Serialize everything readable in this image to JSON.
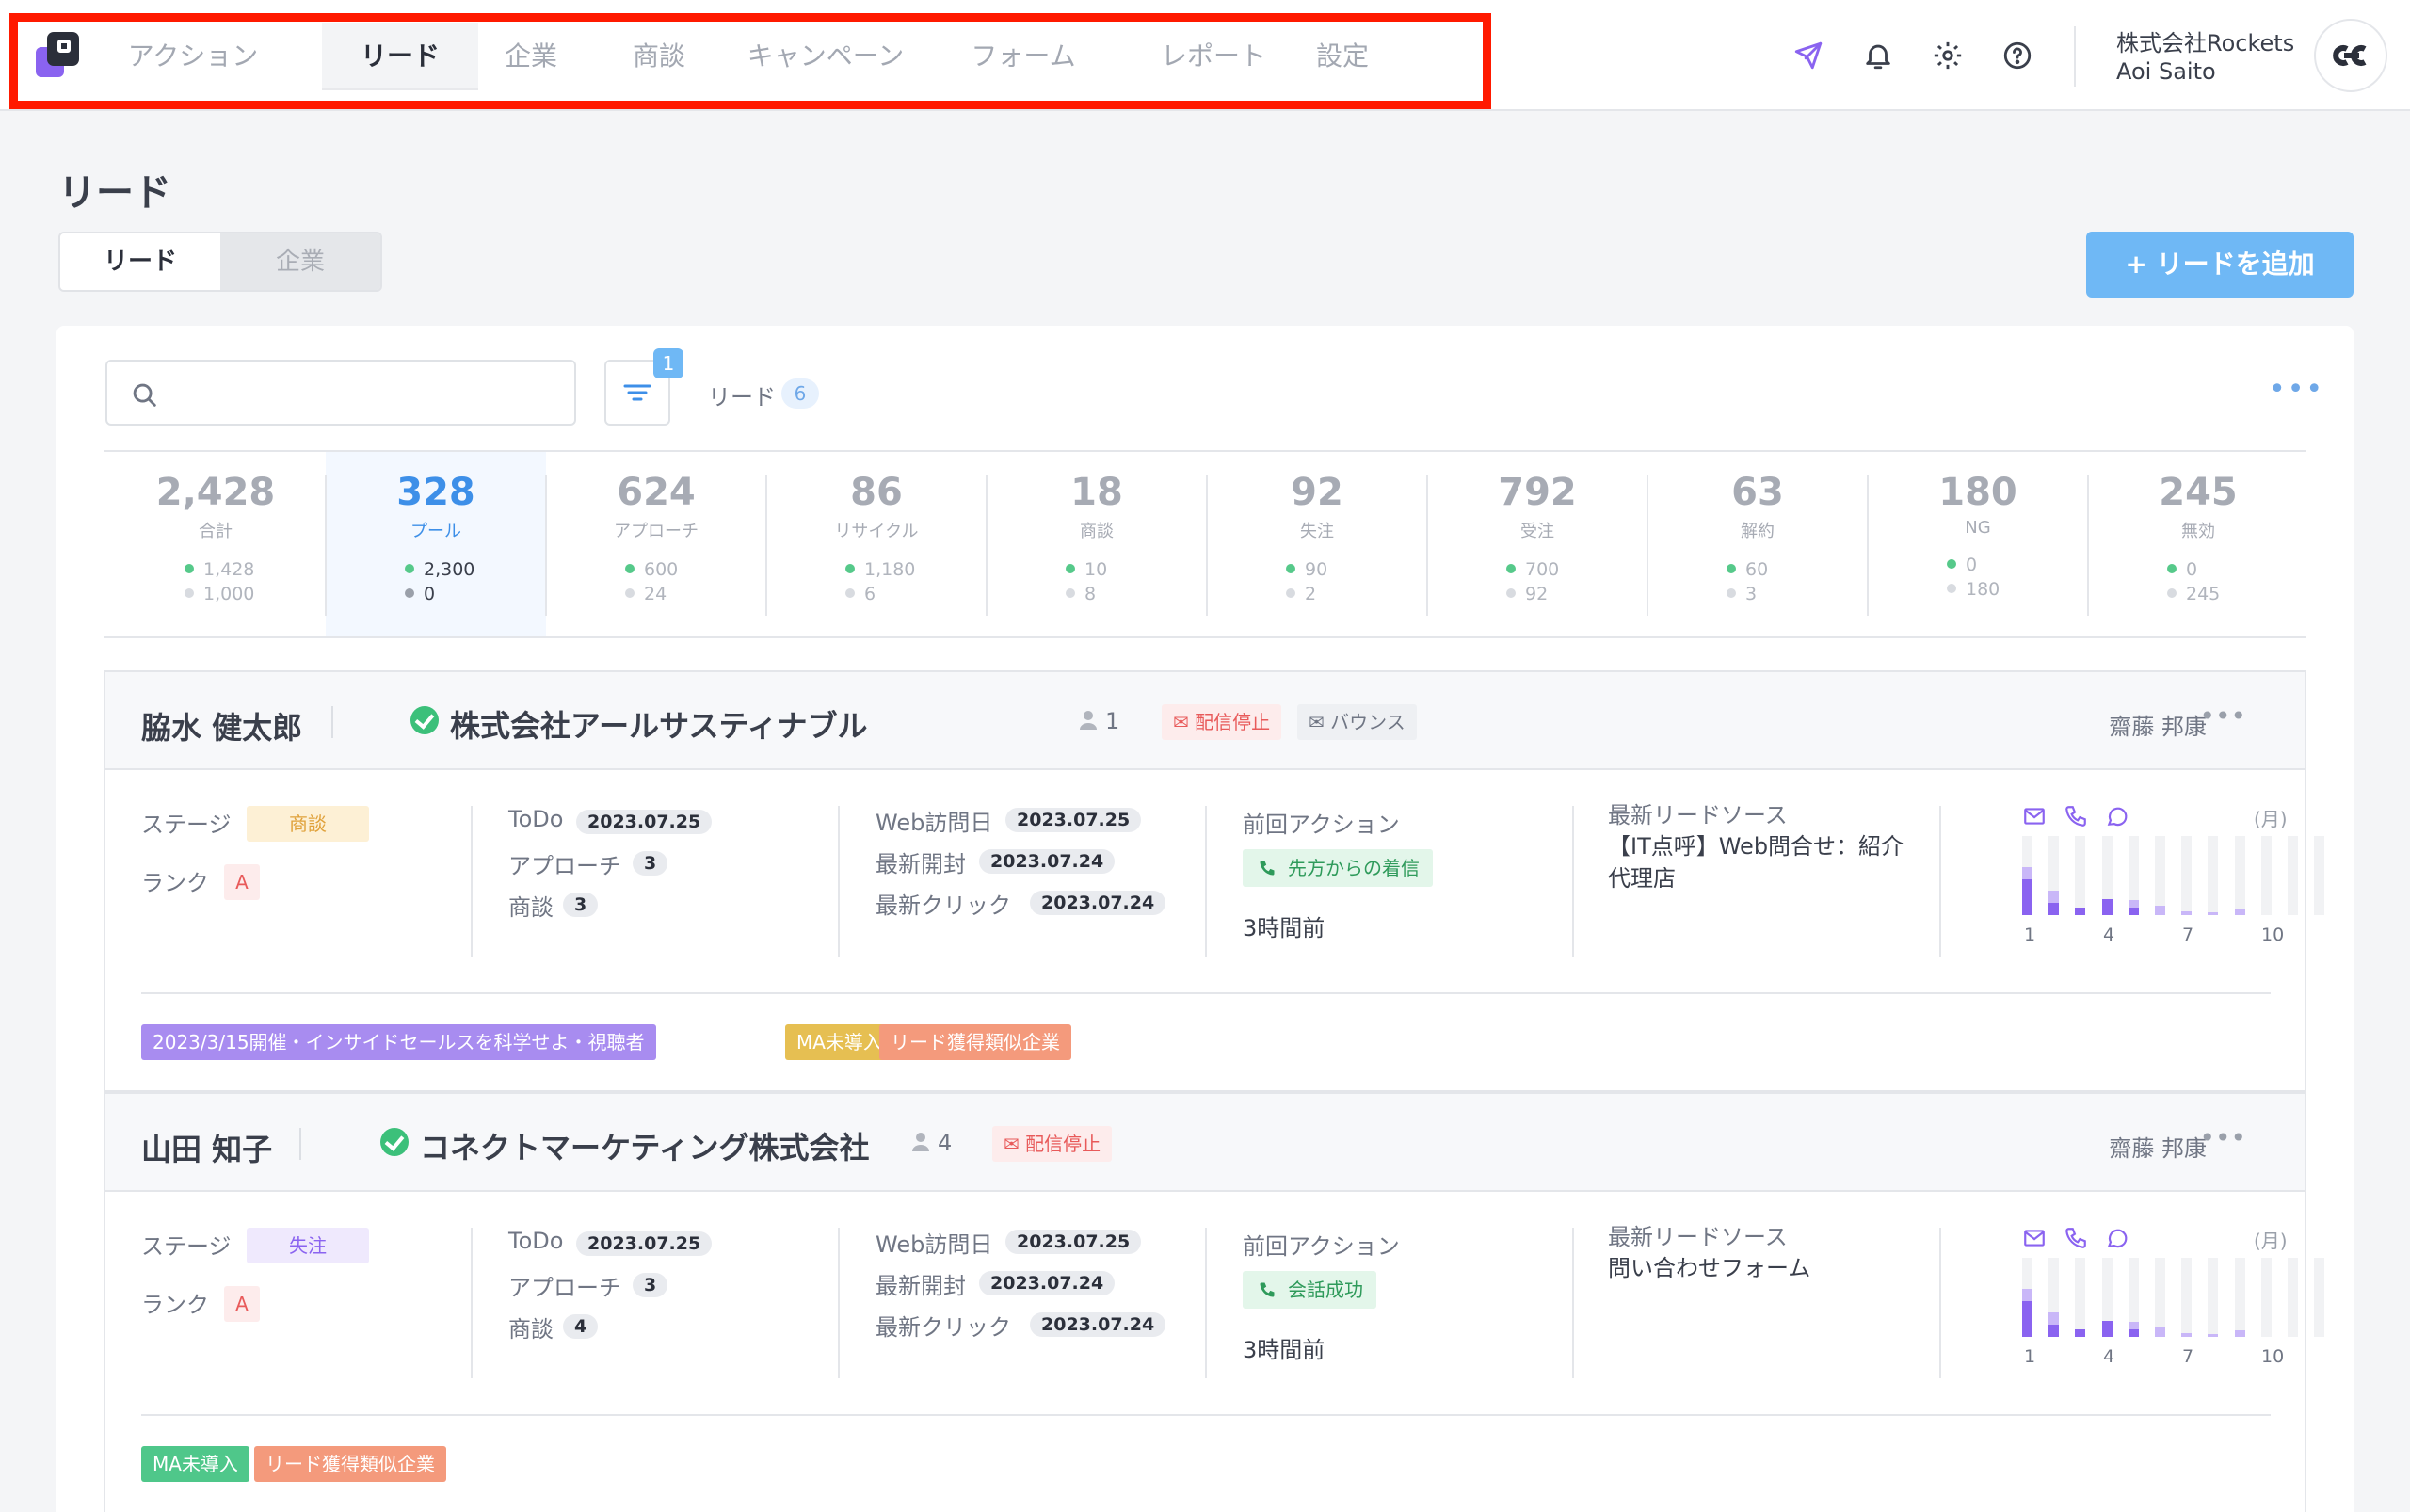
{
  "nav": {
    "items": [
      {
        "label": "アクション",
        "active": false
      },
      {
        "label": "リード",
        "active": true
      },
      {
        "label": "企業",
        "active": false
      },
      {
        "label": "商談",
        "active": false
      },
      {
        "label": "キャンペーン",
        "active": false
      },
      {
        "label": "フォーム",
        "active": false
      },
      {
        "label": "レポート",
        "active": false
      },
      {
        "label": "設定",
        "active": false
      }
    ],
    "icons": [
      "send-icon",
      "bell-icon",
      "gear-icon",
      "help-icon"
    ]
  },
  "user": {
    "company": "株式会社Rockets",
    "name": "Aoi Saito"
  },
  "page": {
    "title": "リード",
    "segments": [
      "リード",
      "企業"
    ],
    "add_button": "+ リードを追加"
  },
  "toolbar": {
    "search_value": "",
    "filter_count": "1",
    "lead_label": "リード",
    "lead_count": "6",
    "more": "•••"
  },
  "stats": [
    {
      "num": "2,428",
      "label": "合計",
      "a": "1,428",
      "b": "1,000",
      "active": false
    },
    {
      "num": "328",
      "label": "プール",
      "a": "2,300",
      "b": "0",
      "active": true
    },
    {
      "num": "624",
      "label": "アプローチ",
      "a": "600",
      "b": "24",
      "active": false
    },
    {
      "num": "86",
      "label": "リサイクル",
      "a": "1,180",
      "b": "6",
      "active": false
    },
    {
      "num": "18",
      "label": "商談",
      "a": "10",
      "b": "8",
      "active": false
    },
    {
      "num": "92",
      "label": "失注",
      "a": "90",
      "b": "2",
      "active": false
    },
    {
      "num": "792",
      "label": "受注",
      "a": "700",
      "b": "92",
      "active": false
    },
    {
      "num": "63",
      "label": "解約",
      "a": "60",
      "b": "3",
      "active": false
    },
    {
      "num": "180",
      "label": "NG",
      "a": "0",
      "b": "180",
      "active": false
    },
    {
      "num": "245",
      "label": "無効",
      "a": "0",
      "b": "245",
      "active": false
    }
  ],
  "labels": {
    "stage": "ステージ",
    "rank": "ランク",
    "todo": "ToDo",
    "approach": "アプローチ",
    "deal": "商談",
    "web_visit": "Web訪問日",
    "last_open": "最新開封",
    "last_click": "最新クリック",
    "last_action": "前回アクション",
    "lead_source": "最新リードソース",
    "month_unit": "(月)",
    "axis": [
      "1",
      "4",
      "7",
      "10"
    ]
  },
  "leads": [
    {
      "name": "脇水 健太郎",
      "company": "株式会社アールサスティナブル",
      "people": "1",
      "tags_status": [
        "配信停止",
        "バウンス"
      ],
      "owner": "齋藤 邦康",
      "stage": "商談",
      "stage_color": "#fdf0d5",
      "stage_text_color": "#e0a13a",
      "rank": "A",
      "todo": "2023.07.25",
      "approach": "3",
      "deal": "3",
      "web_visit": "2023.07.25",
      "last_open": "2023.07.24",
      "last_click": "2023.07.24",
      "action": "先方からの着信",
      "action_time": "3時間前",
      "source": "【IT点呼】Web問合せ：紹介代理店",
      "activity": [
        {
          "dark": 0.45,
          "light": 0.15
        },
        {
          "dark": 0.15,
          "light": 0.15
        },
        {
          "dark": 0.1,
          "light": 0.0
        },
        {
          "dark": 0.2,
          "light": 0.0
        },
        {
          "dark": 0.1,
          "light": 0.1
        },
        {
          "dark": 0.0,
          "light": 0.12
        },
        {
          "dark": 0.0,
          "light": 0.05
        },
        {
          "dark": 0.0,
          "light": 0.04
        },
        {
          "dark": 0.0,
          "light": 0.08
        },
        {
          "dark": 0.0,
          "light": 0.0
        },
        {
          "dark": 0.0,
          "light": 0.0
        },
        {
          "dark": 0.0,
          "light": 0.0
        }
      ],
      "chips": [
        {
          "label": "2023/3/15開催・インサイドセールスを科学せよ・視聴者",
          "color": "#a88cf0"
        },
        {
          "label": "MA未導入",
          "color": "#e6bf52"
        },
        {
          "label": "リード獲得類似企業",
          "color": "#f49a7c"
        }
      ]
    },
    {
      "name": "山田 知子",
      "company": "コネクトマーケティング株式会社",
      "people": "4",
      "tags_status": [
        "配信停止"
      ],
      "owner": "齋藤 邦康",
      "stage": "失注",
      "stage_color": "#efe9fd",
      "stage_text_color": "#8a63f0",
      "rank": "A",
      "todo": "2023.07.25",
      "approach": "3",
      "deal": "4",
      "web_visit": "2023.07.25",
      "last_open": "2023.07.24",
      "last_click": "2023.07.24",
      "action": "会話成功",
      "action_time": "3時間前",
      "source": "問い合わせフォーム",
      "activity": [
        {
          "dark": 0.45,
          "light": 0.15
        },
        {
          "dark": 0.15,
          "light": 0.15
        },
        {
          "dark": 0.1,
          "light": 0.0
        },
        {
          "dark": 0.2,
          "light": 0.0
        },
        {
          "dark": 0.1,
          "light": 0.1
        },
        {
          "dark": 0.0,
          "light": 0.12
        },
        {
          "dark": 0.0,
          "light": 0.05
        },
        {
          "dark": 0.0,
          "light": 0.04
        },
        {
          "dark": 0.0,
          "light": 0.08
        },
        {
          "dark": 0.0,
          "light": 0.0
        },
        {
          "dark": 0.0,
          "light": 0.0
        },
        {
          "dark": 0.0,
          "light": 0.0
        }
      ],
      "chips": [
        {
          "label": "MA未導入",
          "color": "#4fc78a"
        },
        {
          "label": "リード獲得類似企業",
          "color": "#f49a7c"
        }
      ]
    }
  ]
}
